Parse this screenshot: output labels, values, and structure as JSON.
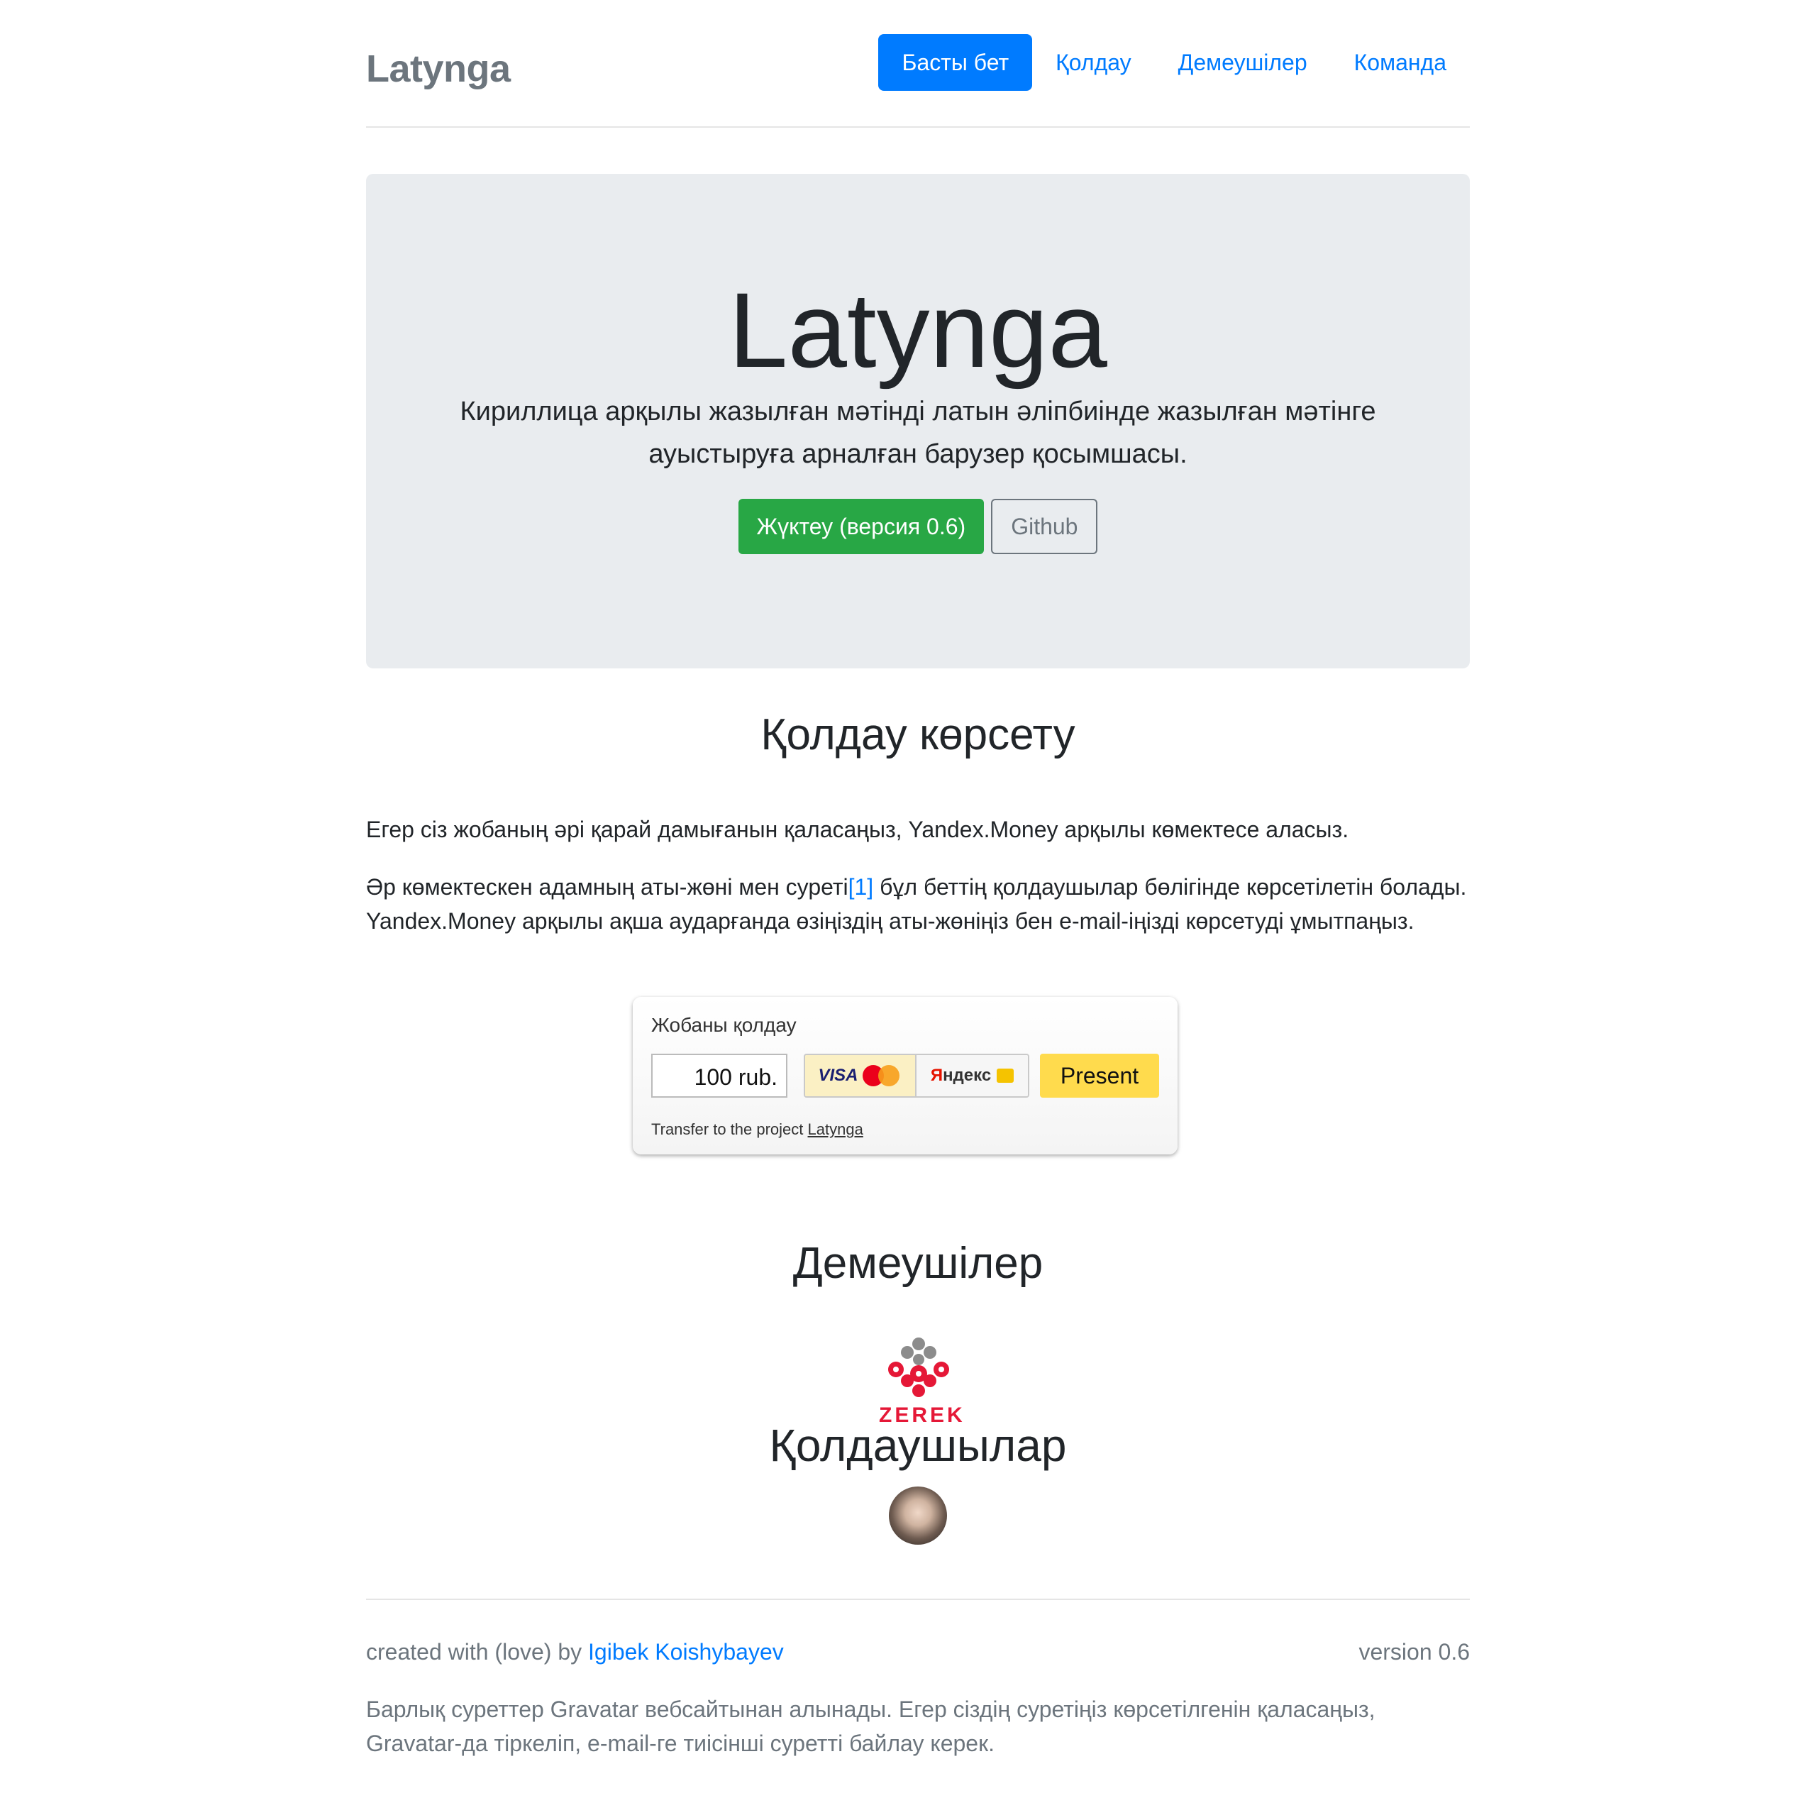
{
  "header": {
    "brand": "Latynga",
    "nav": [
      {
        "label": "Басты бет",
        "active": true
      },
      {
        "label": "Қолдау",
        "active": false
      },
      {
        "label": "Демеушілер",
        "active": false
      },
      {
        "label": "Команда",
        "active": false
      }
    ]
  },
  "hero": {
    "title": "Latynga",
    "lead": "Кириллица арқылы жазылған мәтінді латын әліпбиінде жазылған мәтінге ауыстыруға арналған барузер қосымшасы.",
    "download_label": "Жүктеу (версия 0.6)",
    "github_label": "Github"
  },
  "support": {
    "heading": "Қолдау көрсету",
    "paragraph1": "Егер сіз жобаның әрі қарай дамығанын қаласаңыз, Yandex.Money арқылы көмектесе аласыз.",
    "paragraph2_before": "Әр көмектескен адамның аты-жөні мен суреті",
    "paragraph2_link": "[1]",
    "paragraph2_after": " бұл беттің қолдаушылар бөлігінде көрсетілетін болады. Yandex.Money арқылы ақша аударғанда өзіңіздің аты-жөніңіз бен e-mail-іңізді көрсетуді ұмытпаңыз."
  },
  "widget": {
    "title": "Жобаны қолдау",
    "amount": "100 rub.",
    "card_label": "VISA",
    "yandex_label_prefix": "Я",
    "yandex_label_rest": "ндекс",
    "present_label": "Present",
    "transfer_text": "Transfer to the project ",
    "transfer_link": "Latynga"
  },
  "sponsors": {
    "heading": "Демеушілер",
    "sponsor_name": "ZEREK",
    "supporters_heading": "Қолдаушылар"
  },
  "footer": {
    "created_text": "created with (love) by ",
    "author": "Igibek Koishybayev",
    "version": "version 0.6",
    "note": "Барлық суреттер Gravatar вебсайтынан алынады. Егер сіздің суретіңіз көрсетілгенін қаласаңыз, Gravatar-да тіркеліп, e-mail-ге тиісінші суретті байлау керек."
  },
  "colors": {
    "primary": "#007bff",
    "success": "#28a745",
    "muted": "#6c757d",
    "jumbotron_bg": "#e9ecef",
    "present_yellow": "#ffdb4d",
    "zerek_red": "#e51837"
  }
}
